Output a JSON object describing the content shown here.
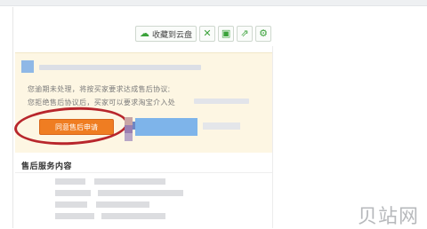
{
  "toolbar": {
    "save_cloud_label": "收藏到云盘",
    "icons": [
      "cloud-icon",
      "expand-icon",
      "save-icon",
      "share-icon",
      "settings-icon"
    ]
  },
  "notice": {
    "line1": "您逾期未处理，将按买家要求达成售后协议;",
    "line2": "您拒绝售后协议后，买家可以要求淘宝介入处",
    "agree_button": "同意售后申请"
  },
  "section": {
    "title": "售后服务内容"
  },
  "watermark": "贝站网",
  "colors": {
    "accent_orange": "#ef7d22",
    "annotation_red": "#b8262c",
    "notice_bg": "#fdf6e3",
    "icon_green": "#3aa23a"
  }
}
